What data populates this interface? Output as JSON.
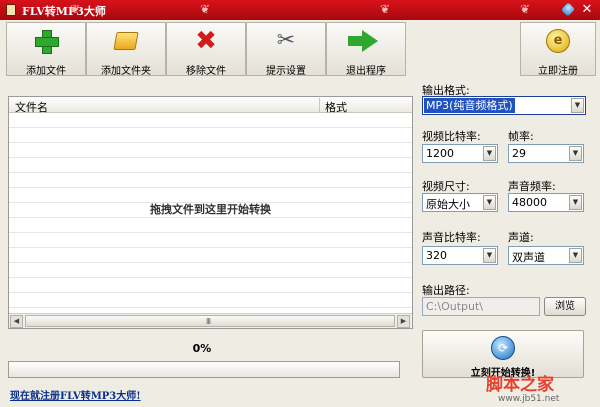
{
  "window": {
    "title": "FLV转MP3大师"
  },
  "toolbar": {
    "add_file": "添加文件",
    "add_folder": "添加文件夹",
    "remove_file": "移除文件",
    "settings": "提示设置",
    "exit": "退出程序",
    "register": "立即注册"
  },
  "file_list": {
    "columns": [
      "文件名",
      "格式"
    ],
    "drop_hint": "拖拽文件到这里开始转换",
    "rows": []
  },
  "progress": {
    "percent_text": "0%",
    "value": 0
  },
  "register_link": "现在就注册FLV转MP3大师!",
  "options": {
    "output_format": {
      "label": "输出格式:",
      "value": "MP3(纯音频格式)"
    },
    "video_bitrate": {
      "label": "视频比特率:",
      "value": "1200"
    },
    "frame_rate": {
      "label": "帧率:",
      "value": "29"
    },
    "video_size": {
      "label": "视频尺寸:",
      "value": "原始大小"
    },
    "audio_sample_rate": {
      "label": "声音频率:",
      "value": "48000"
    },
    "audio_bitrate": {
      "label": "声音比特率:",
      "value": "320"
    },
    "audio_channels": {
      "label": "声道:",
      "value": "双声道"
    },
    "output_path": {
      "label": "输出路径:",
      "value": "C:\\Output\\"
    },
    "browse": "浏览",
    "convert": "立刻开始转换!"
  },
  "watermark": {
    "text": "脚本之家",
    "url": "www.jb51.net"
  },
  "colors": {
    "titlebar": "#c8101a",
    "selection": "#2153c0",
    "link": "#0b2f8c"
  }
}
